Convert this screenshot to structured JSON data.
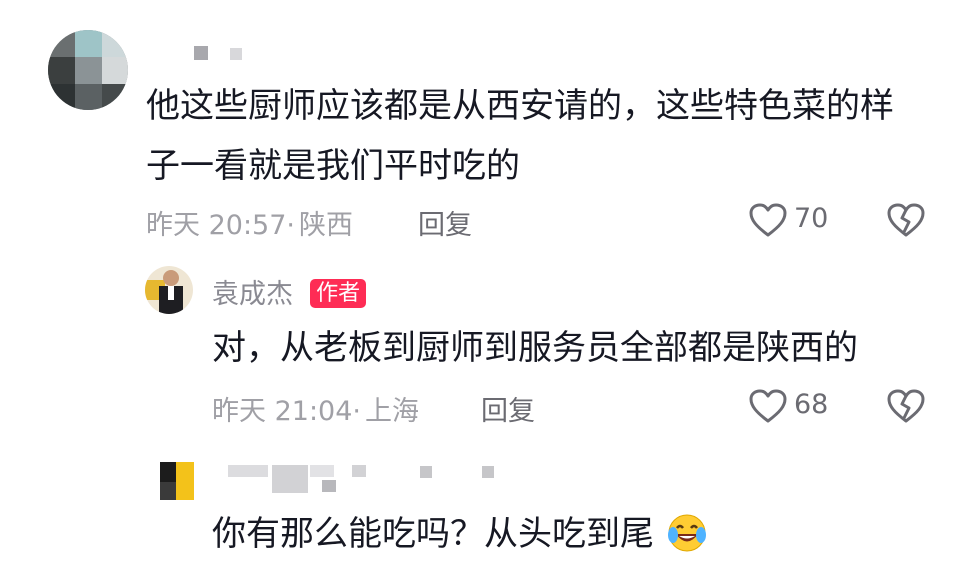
{
  "comments": [
    {
      "text_line1": "他这些厨师应该都是从西安请的，这些特色菜的样",
      "text_line2": "子一看就是我们平时吃的",
      "time": "昨天 20:57",
      "separator": "·",
      "location": "陕西",
      "reply_label": "回复",
      "likes": "70"
    },
    {
      "author": "袁成杰",
      "badge": "作者",
      "text": "对，从老板到厨师到服务员全部都是陕西的",
      "time": "昨天 21:04",
      "separator": "·",
      "location": "上海",
      "reply_label": "回复",
      "likes": "68"
    },
    {
      "text": "你有那么能吃吗？从头吃到尾",
      "emoji": "😂"
    }
  ],
  "colors": {
    "badge": "#fe2c55",
    "meta": "#a0a0a6"
  },
  "icons": [
    "heart-outline-icon",
    "broken-heart-icon",
    "laughing-crying-emoji"
  ]
}
